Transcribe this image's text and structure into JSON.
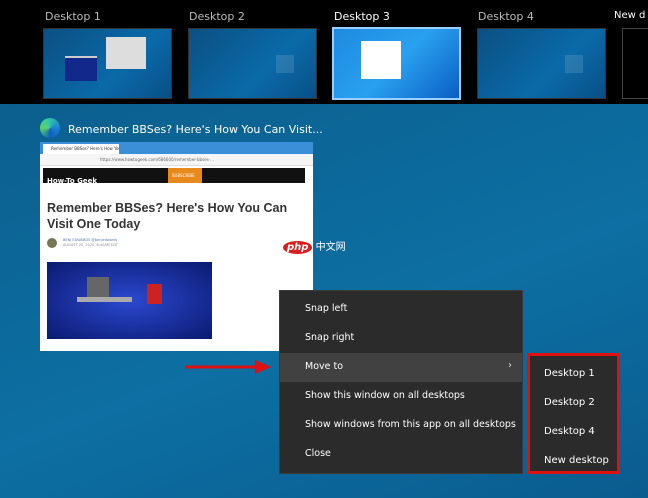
{
  "desktops": [
    {
      "label": "Desktop 1"
    },
    {
      "label": "Desktop 2"
    },
    {
      "label": "Desktop 3",
      "selected": true
    },
    {
      "label": "Desktop 4"
    },
    {
      "label": "New d"
    }
  ],
  "window": {
    "title": "Remember BBSes? Here's How You Can Visit...",
    "tab": "Remember BBSes? Here's How You...",
    "url": "https://www.howtogeek.com/686600/remember-bbses-...",
    "site": "How-To Geek",
    "subscribe": "SUBSCRIBE",
    "headline": "Remember BBSes? Here's How You Can Visit One Today",
    "author": "BENJ EDWARDS",
    "handle": "@benjedwards",
    "date": "AUGUST 25, 2020, 6:40AM EDT"
  },
  "watermark": {
    "logo": "php",
    "text": "中文网"
  },
  "context_menu": {
    "items": [
      "Snap left",
      "Snap right",
      "Move to",
      "Show this window on all desktops",
      "Show windows from this app on all desktops",
      "Close"
    ],
    "highlighted": "Move to"
  },
  "submenu": {
    "items": [
      "Desktop 1",
      "Desktop 2",
      "Desktop 4",
      "New desktop"
    ]
  },
  "colors": {
    "highlight_border": "#e01010",
    "menu_bg": "#2b2b2b"
  }
}
